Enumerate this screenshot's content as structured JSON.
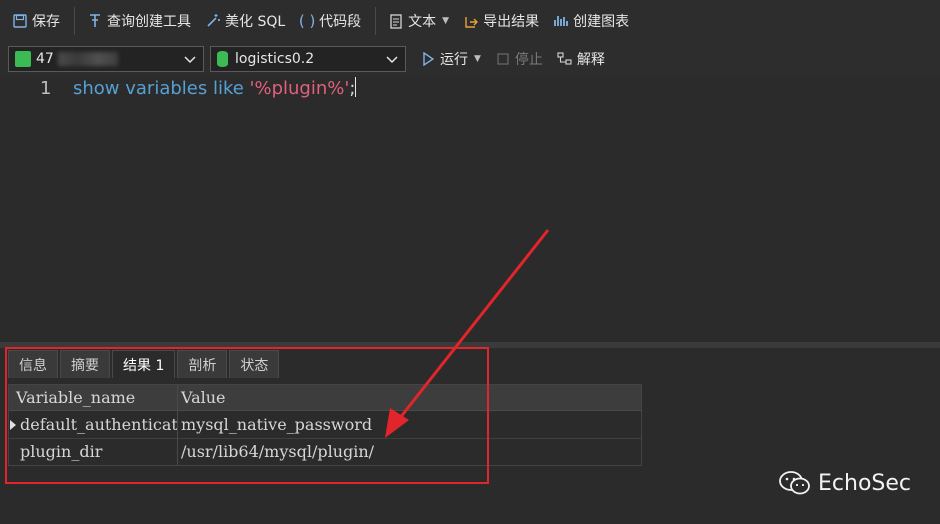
{
  "toolbar": {
    "save": "保存",
    "query_builder": "查询创建工具",
    "beautify_sql": "美化 SQL",
    "snippet": "代码段",
    "text": "文本",
    "export": "导出结果",
    "create_chart": "创建图表"
  },
  "toolbar2": {
    "connection_prefix": "47",
    "database": "logistics0.2",
    "run": "运行",
    "stop": "停止",
    "explain": "解释"
  },
  "editor": {
    "line_number": "1",
    "code_keyword": "show variables like ",
    "code_string": "'%plugin%'",
    "code_end": ";"
  },
  "result_tabs": [
    "信息",
    "摘要",
    "结果 1",
    "剖析",
    "状态"
  ],
  "active_tab": "结果 1",
  "grid": {
    "columns": [
      "Variable_name",
      "Value"
    ],
    "rows": [
      [
        "default_authentication_plugin",
        "mysql_native_password"
      ],
      [
        "plugin_dir",
        "/usr/lib64/mysql/plugin/"
      ]
    ]
  },
  "watermark": "EchoSec",
  "colors": {
    "background": "#2b2b2b",
    "keyword": "#56a0d3",
    "string": "#e0607e",
    "highlight_box": "#e2252b",
    "arrow": "#e2252b"
  }
}
